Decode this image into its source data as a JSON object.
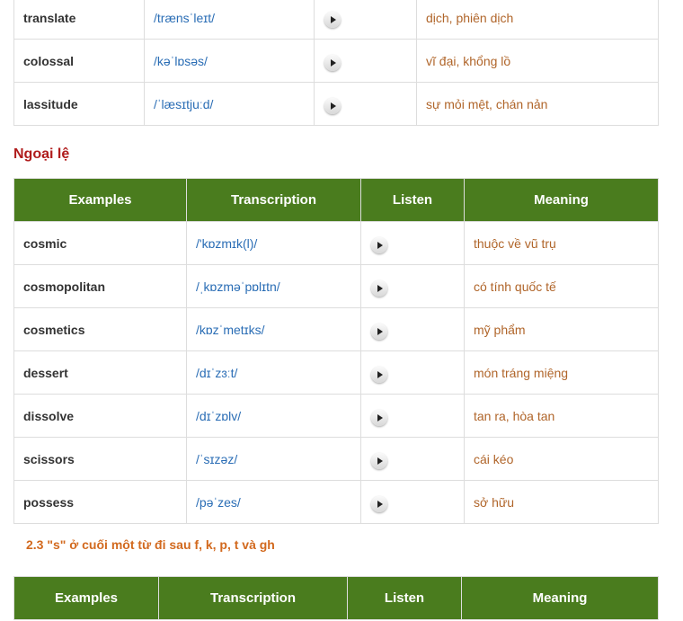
{
  "table1": {
    "rows": [
      {
        "word": "translate",
        "transcription": "/trænsˈleɪt/",
        "meaning": "dịch, phiên dịch"
      },
      {
        "word": "colossal",
        "transcription": "/kəˈlɒsəs/",
        "meaning": "vĩ đại, khổng lồ"
      },
      {
        "word": "lassitude",
        "transcription": "/ˈlæsɪtjuːd/",
        "meaning": "sự mỏi mệt, chán nản"
      }
    ]
  },
  "exceptions_heading": "Ngoại lệ",
  "headers": {
    "examples": "Examples",
    "transcription": "Transcription",
    "listen": "Listen",
    "meaning": "Meaning"
  },
  "table2": {
    "rows": [
      {
        "word": "cosmic",
        "transcription": "/'kɒzmɪk(l)/",
        "meaning": "thuộc về vũ trụ"
      },
      {
        "word": "cosmopolitan",
        "transcription": "/ˌkɒzməˈpɒlɪtn/",
        "meaning": "có tính quốc tế"
      },
      {
        "word": "cosmetics",
        "transcription": "/kɒzˈmetɪks/",
        "meaning": "mỹ phẩm"
      },
      {
        "word": "dessert",
        "transcription": "/dɪˈzɜːt/",
        "meaning": "món tráng miệng"
      },
      {
        "word": "dissolve",
        "transcription": "/dɪˈzɒlv/",
        "meaning": "tan ra, hòa tan"
      },
      {
        "word": "scissors",
        "transcription": "/ˈsɪzəz/",
        "meaning": "cái kéo"
      },
      {
        "word": "possess",
        "transcription": "/pəˈzes/",
        "meaning": "sở hữu"
      }
    ]
  },
  "section_heading": "2.3 \"s\" ở cuối một từ đi sau f, k, p, t và gh"
}
